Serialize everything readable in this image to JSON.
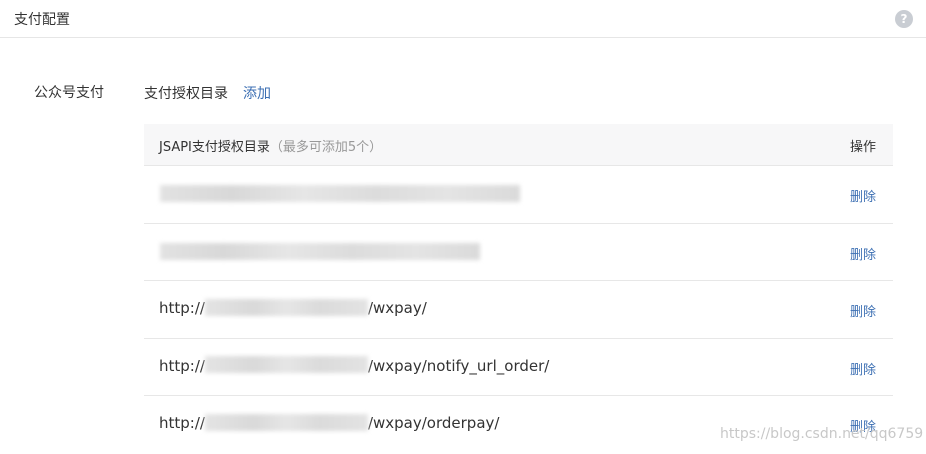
{
  "header": {
    "title": "支付配置",
    "help_icon": "?"
  },
  "section": {
    "label": "公众号支付",
    "sub_label": "支付授权目录",
    "add_label": "添加"
  },
  "table": {
    "header_title": "JSAPI支付授权目录",
    "header_hint": "（最多可添加5个）",
    "header_ops": "操作",
    "rows": [
      {
        "prefix": "",
        "suffix": "",
        "delete_label": "删除"
      },
      {
        "prefix": "",
        "suffix": "",
        "delete_label": "删除"
      },
      {
        "prefix": "http://",
        "suffix": "/wxpay/",
        "delete_label": "删除"
      },
      {
        "prefix": "http://",
        "suffix": "/wxpay/notify_url_order/",
        "delete_label": "删除"
      },
      {
        "prefix": "http://",
        "suffix": "/wxpay/orderpay/",
        "delete_label": "删除"
      }
    ]
  },
  "watermark": "https://blog.csdn.net/qq6759"
}
